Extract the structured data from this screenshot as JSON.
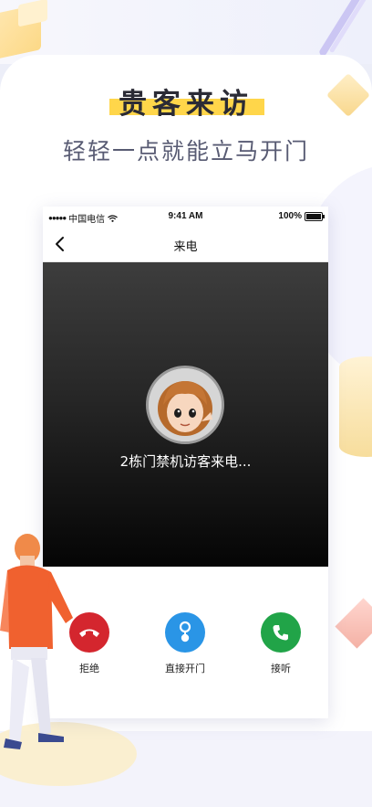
{
  "promo": {
    "headline": "贵客来访",
    "subheadline": "轻轻一点就能立马开门"
  },
  "status_bar": {
    "carrier": "中国电信",
    "time": "9:41 AM",
    "battery": "100%"
  },
  "nav": {
    "title": "来电"
  },
  "call": {
    "caller_text": "2栋门禁机访客来电..."
  },
  "controls": {
    "reject_label": "拒绝",
    "open_door_label": "直接开门",
    "answer_label": "接听"
  },
  "colors": {
    "headline_highlight": "#ffd64a",
    "reject": "#d4262e",
    "open_door": "#2a95e6",
    "answer": "#21a448"
  },
  "icons": {
    "back": "chevron-left-icon",
    "wifi": "wifi-icon",
    "battery": "battery-icon",
    "reject": "hang-up-phone-icon",
    "open_door": "key-icon",
    "answer": "phone-icon"
  }
}
